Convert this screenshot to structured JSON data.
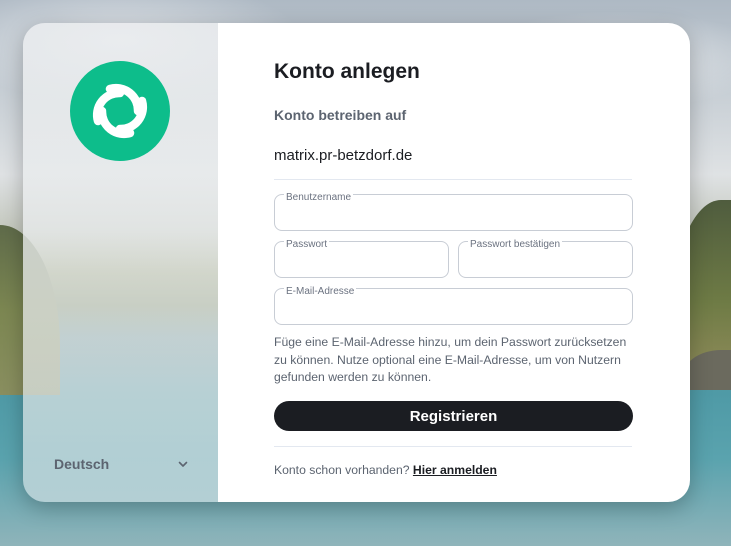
{
  "brand": {
    "logo_icon": "element-logo-icon",
    "logo_color": "#0dbd8b"
  },
  "language": {
    "label": "Deutsch",
    "icon": "chevron-down-icon"
  },
  "form": {
    "title": "Konto anlegen",
    "server_label": "Konto betreiben auf",
    "server_value": "matrix.pr-betzdorf.de",
    "fields": {
      "username": {
        "label": "Benutzername",
        "value": ""
      },
      "password": {
        "label": "Passwort",
        "value": ""
      },
      "password_confirm": {
        "label": "Passwort bestätigen",
        "value": ""
      },
      "email": {
        "label": "E-Mail-Adresse",
        "value": ""
      }
    },
    "help_text": "Füge eine E-Mail-Adresse hinzu, um dein Passwort zurücksetzen zu können. Nutze optional eine E-Mail-Adresse, um von Nutzern gefunden werden zu können.",
    "submit_label": "Registrieren",
    "footer_text": "Konto schon vorhanden?",
    "login_link": "Hier anmelden"
  },
  "colors": {
    "accent": "#0dbd8b",
    "button_bg": "#1b1d22",
    "text_primary": "#1b1d22",
    "text_secondary": "#5c6470"
  }
}
